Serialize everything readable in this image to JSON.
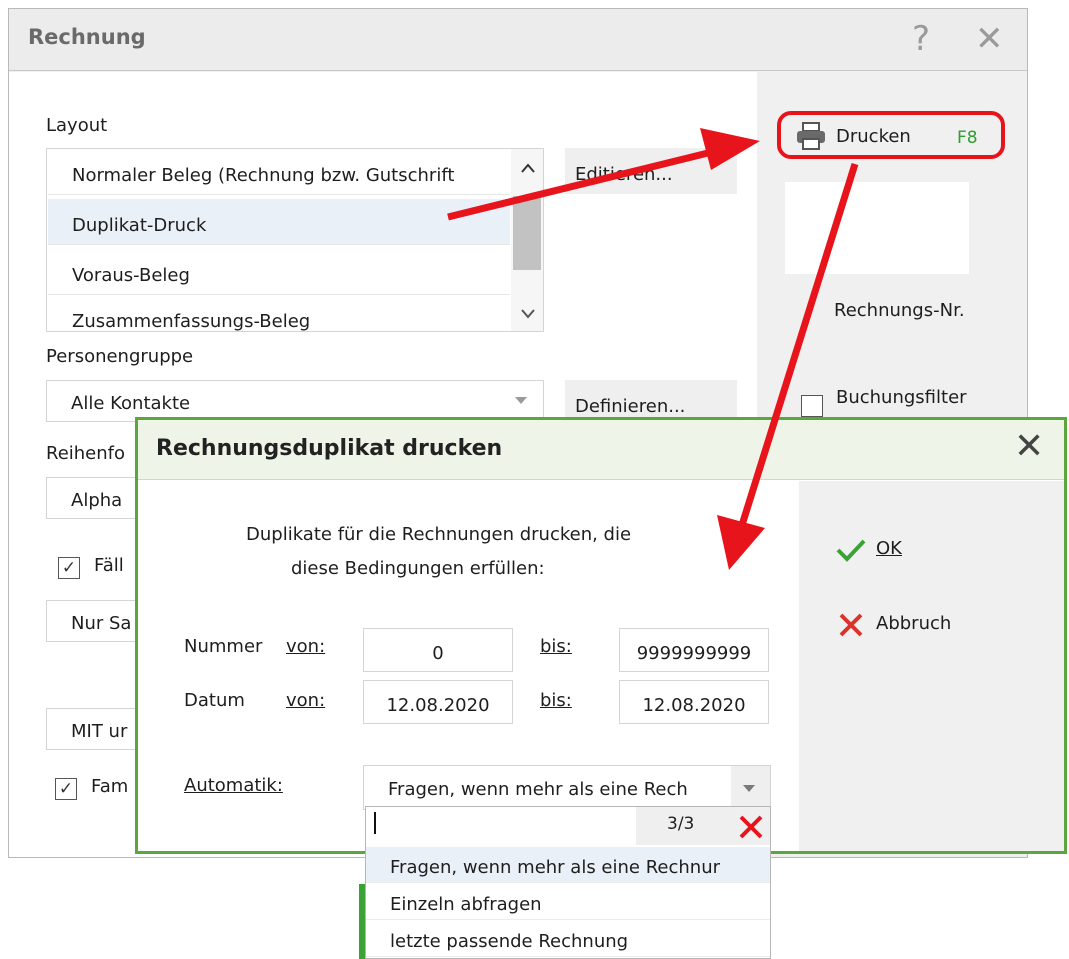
{
  "window": {
    "title": "Rechnung",
    "help_glyph": "?",
    "close_glyph": "✕"
  },
  "layout": {
    "label": "Layout",
    "items": [
      "Normaler Beleg (Rechnung bzw. Gutschrift",
      "Duplikat-Druck",
      "Voraus-Beleg",
      "Zusammenfassungs-Beleg"
    ],
    "edit_button": "Editieren..."
  },
  "personengruppe": {
    "label": "Personengruppe",
    "value": "Alle Kontakte",
    "define_button": "Definieren..."
  },
  "reihenfolge": {
    "label": "Reihenfo",
    "value": "Alpha"
  },
  "faellig": {
    "label": "Fäll",
    "checked": true
  },
  "nur": {
    "value": "Nur Sa"
  },
  "mit": {
    "value": "MIT ur"
  },
  "familie": {
    "label": "Fam",
    "checked": true
  },
  "right_panel": {
    "print_label": "Drucken",
    "print_shortcut": "F8",
    "rechnungs_nr_label": "Rechnungs-Nr.",
    "buchungsfilter_label": "Buchungsfilter"
  },
  "dialog": {
    "title": "Rechnungsduplikat drucken",
    "close_glyph": "✕",
    "description_line1": "Duplikate für die Rechnungen drucken, die",
    "description_line2": "diese Bedingungen erfüllen:",
    "nummer_label": "Nummer",
    "datum_label": "Datum",
    "von_label": "von:",
    "bis_label": "bis:",
    "nummer_von": "0",
    "nummer_bis": "9999999999",
    "datum_von": "12.08.2020",
    "datum_bis": "12.08.2020",
    "automatik_label": "Automatik:",
    "automatik_value": "Fragen, wenn mehr als eine Rech",
    "ok_label": "OK",
    "cancel_label": "Abbruch"
  },
  "dropdown": {
    "count": "3/3",
    "options": [
      "Fragen, wenn mehr als eine Rechnur",
      "Einzeln abfragen",
      "letzte passende Rechnung"
    ]
  },
  "colors": {
    "dialog_border": "#5aa83d",
    "annotation_red": "#e8141b",
    "ok_green": "#3aa335",
    "cancel_red": "#d9332b"
  },
  "icons": [
    "help-icon",
    "close-icon",
    "printer-icon",
    "chevron-up-icon",
    "chevron-down-icon",
    "checkmark-icon",
    "cancel-x-icon",
    "clear-icon"
  ]
}
